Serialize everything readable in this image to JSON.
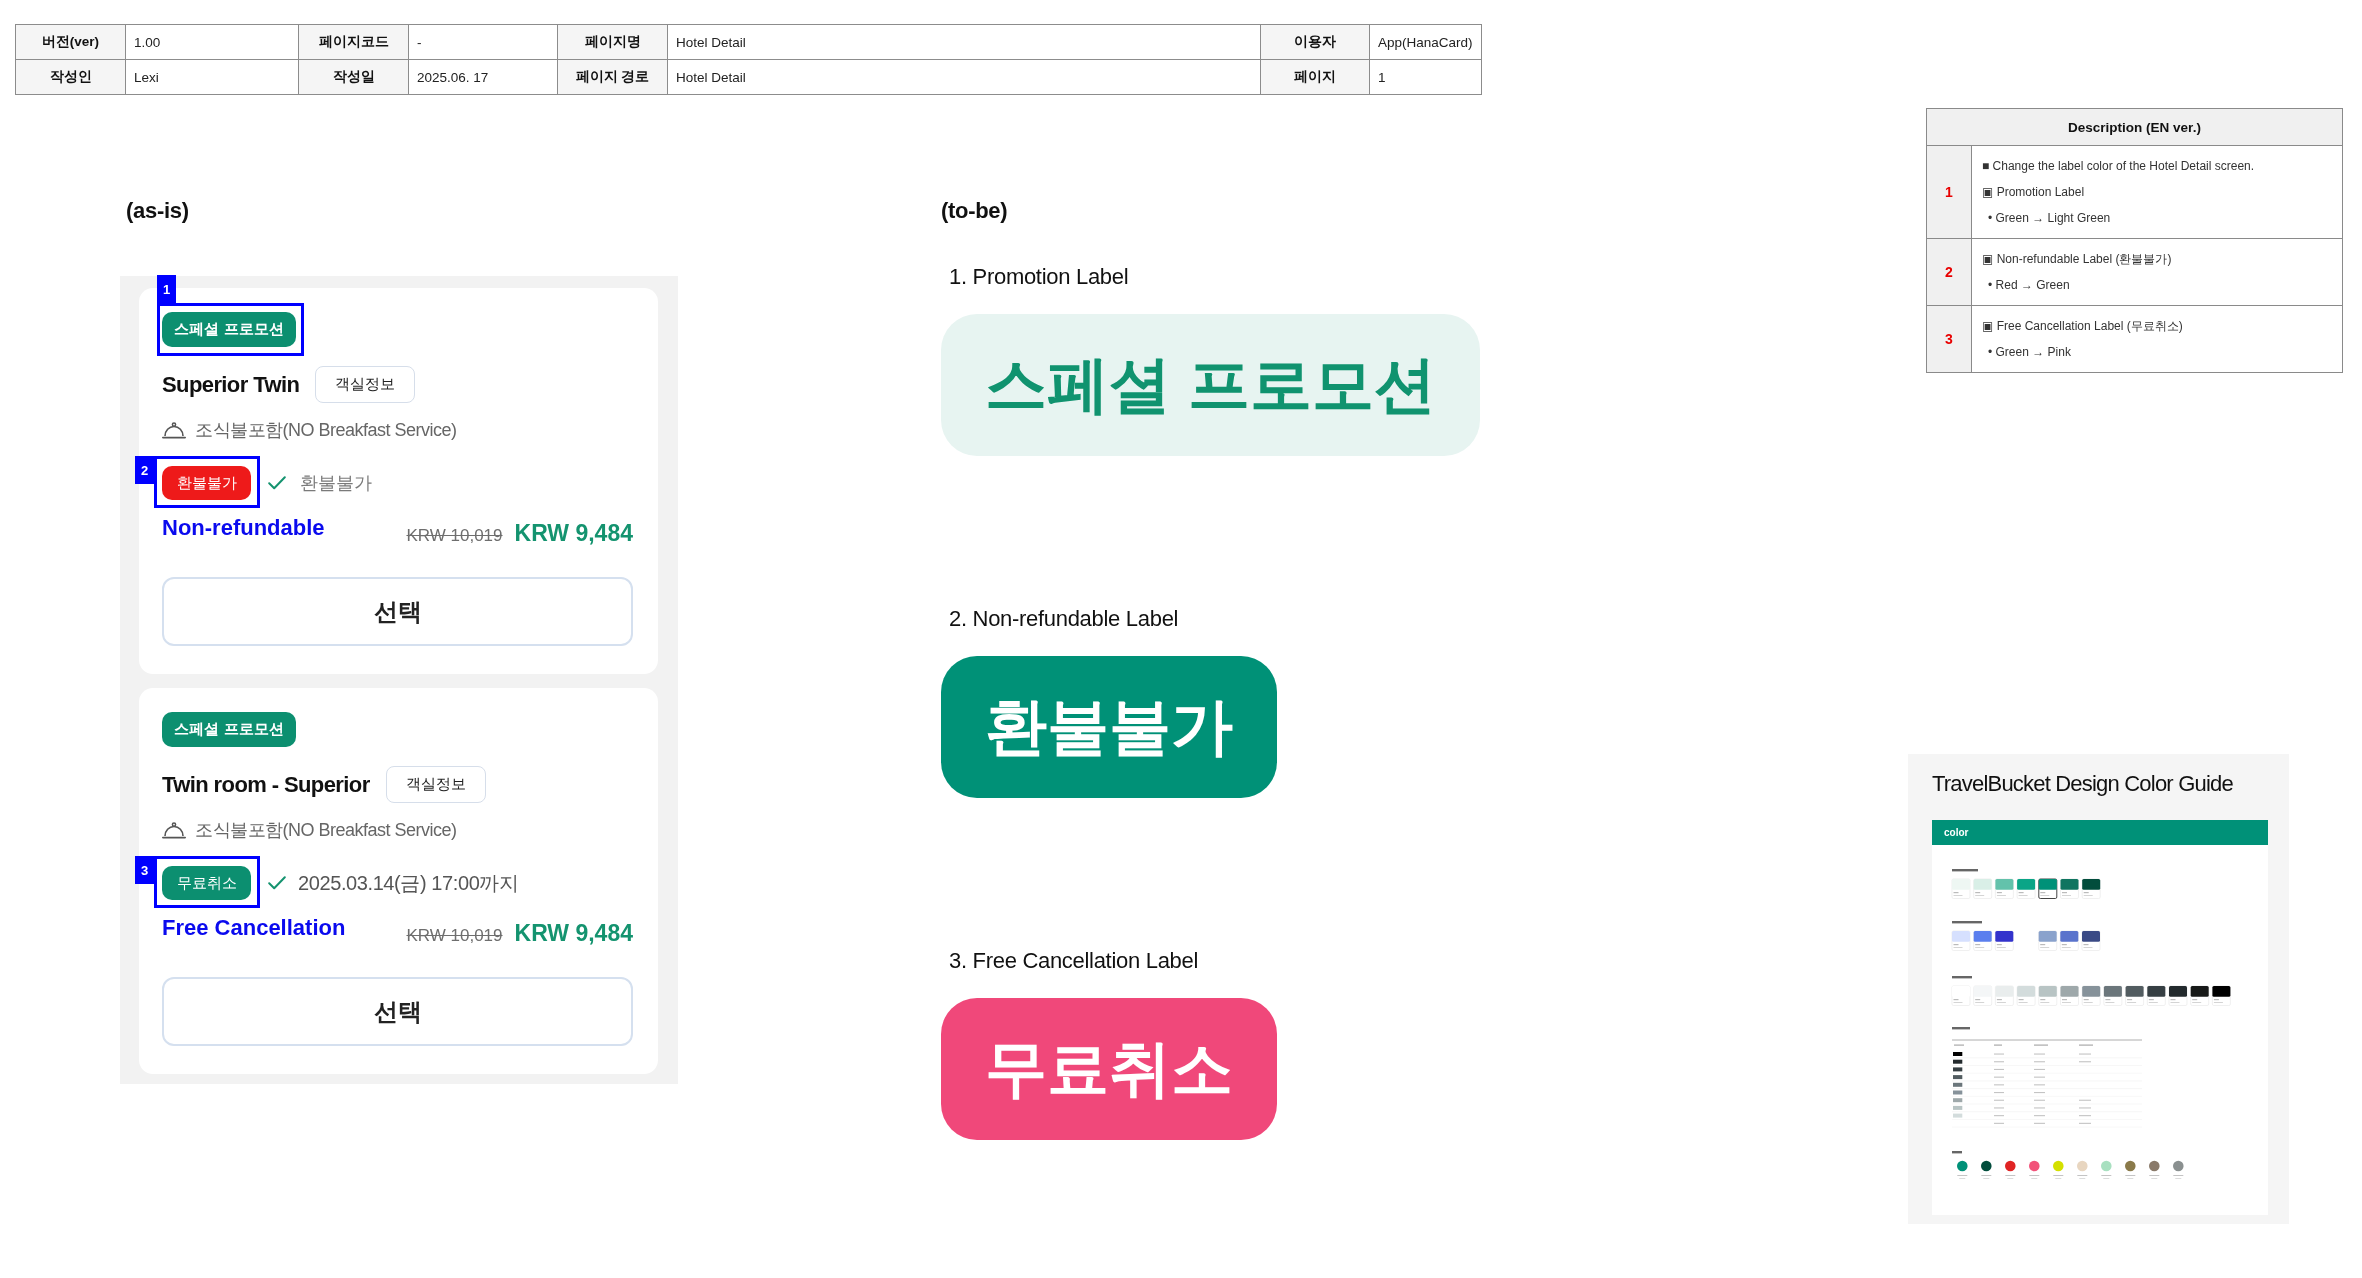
{
  "doc_header": [
    [
      {
        "label": "버전(ver)",
        "value": "1.00"
      },
      {
        "label": "페이지코드",
        "value": "-"
      },
      {
        "label": "페이지명",
        "value": "Hotel Detail"
      },
      {
        "label": "이용자",
        "value": "App(HanaCard)"
      }
    ],
    [
      {
        "label": "작성인",
        "value": "Lexi"
      },
      {
        "label": "작성일",
        "value": "2025.06. 17"
      },
      {
        "label": "페이지 경로",
        "value": "Hotel Detail"
      },
      {
        "label": "페이지",
        "value": "1"
      }
    ]
  ],
  "as_is": {
    "title": "(as-is)",
    "rooms": [
      {
        "promo_label": {
          "text": "스페셜 프로모션",
          "color": "#0c8f70",
          "marker": "1"
        },
        "name": "Superior Twin",
        "info_button": "객실정보",
        "meal": "조식불포함(NO Breakfast Service)",
        "policy": {
          "kind": "non_refundable",
          "label": {
            "text": "환불불가",
            "color": "#ee1a1a",
            "marker": "2"
          },
          "detail": "환불불가"
        },
        "policy_note": "Non-refundable",
        "original_price": "KRW 10,019",
        "price": "KRW 9,484",
        "select_button": "선택"
      },
      {
        "promo_label": {
          "text": "스페셜 프로모션",
          "color": "#0c8f70"
        },
        "name": "Twin room - Superior",
        "info_button": "객실정보",
        "meal": "조식불포함(NO Breakfast Service)",
        "policy": {
          "kind": "free_cancellation",
          "label": {
            "text": "무료취소",
            "color": "#0c8f70",
            "marker": "3"
          },
          "detail": "2025.03.14(금) 17:00까지"
        },
        "policy_note": "Free Cancellation",
        "original_price": "KRW 10,019",
        "price": "KRW 9,484",
        "select_button": "선택"
      }
    ]
  },
  "to_be": {
    "title": "(to-be)",
    "items": [
      {
        "heading": "1. Promotion Label",
        "label": {
          "text": "스페셜 프로모션",
          "kind": "tint",
          "color": "#10936f"
        }
      },
      {
        "heading": "2. Non-refundable Label",
        "label": {
          "text": "환불불가",
          "kind": "solid",
          "color": "#009177"
        }
      },
      {
        "heading": "3. Free Cancellation Label",
        "label": {
          "text": "무료취소",
          "kind": "solid",
          "color": "#f0487a"
        }
      }
    ]
  },
  "description": {
    "title": "Description (EN ver.)",
    "rows": [
      {
        "number": "1",
        "lines": [
          {
            "kind": "note",
            "text": "■ Change the label color of the Hotel Detail screen."
          },
          {
            "kind": "label",
            "text": "▣ Promotion Label"
          },
          {
            "kind": "bullet",
            "text": "• Green → Light Green"
          }
        ]
      },
      {
        "number": "2",
        "lines": [
          {
            "kind": "label",
            "text": "▣ Non-refundable Label (환불불가)"
          },
          {
            "kind": "bullet",
            "text": "• Red → Green"
          }
        ]
      },
      {
        "number": "3",
        "lines": [
          {
            "kind": "label",
            "text": "▣ Free Cancellation Label (무료취소)"
          },
          {
            "kind": "bullet",
            "text": "• Green → Pink"
          }
        ]
      }
    ]
  },
  "color_guide": {
    "title": "TravelBucket Design Color Guide",
    "section_header": "color"
  }
}
